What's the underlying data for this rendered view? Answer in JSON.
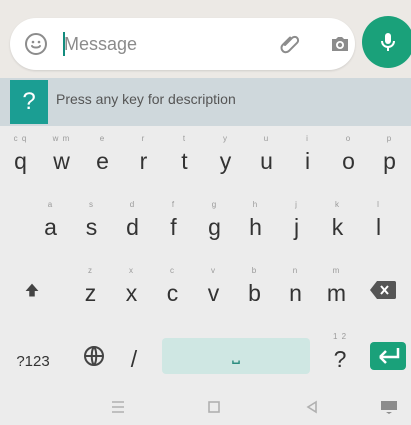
{
  "message": {
    "placeholder": "Message"
  },
  "hint": {
    "badge": "?",
    "text": "Press any key for description"
  },
  "keyboard": {
    "row1": [
      {
        "k": "q",
        "s": "c q"
      },
      {
        "k": "w",
        "s": "w m"
      },
      {
        "k": "e",
        "s": "e"
      },
      {
        "k": "r",
        "s": "r"
      },
      {
        "k": "t",
        "s": "t"
      },
      {
        "k": "y",
        "s": "y"
      },
      {
        "k": "u",
        "s": "u"
      },
      {
        "k": "i",
        "s": "i"
      },
      {
        "k": "o",
        "s": "o"
      },
      {
        "k": "p",
        "s": "p"
      }
    ],
    "row2": [
      {
        "k": "a",
        "s": "a"
      },
      {
        "k": "s",
        "s": "s"
      },
      {
        "k": "d",
        "s": "d"
      },
      {
        "k": "f",
        "s": "f"
      },
      {
        "k": "g",
        "s": "g"
      },
      {
        "k": "h",
        "s": "h"
      },
      {
        "k": "j",
        "s": "j"
      },
      {
        "k": "k",
        "s": "k"
      },
      {
        "k": "l",
        "s": "l"
      }
    ],
    "row3": [
      {
        "k": "z",
        "s": "z"
      },
      {
        "k": "x",
        "s": "x"
      },
      {
        "k": "c",
        "s": "c"
      },
      {
        "k": "v",
        "s": "v"
      },
      {
        "k": "b",
        "s": "b"
      },
      {
        "k": "n",
        "s": "n"
      },
      {
        "k": "m",
        "s": "m"
      }
    ],
    "row4": {
      "symbols": "?123",
      "slash": "/",
      "space": "⎵",
      "question": "?"
    }
  },
  "colors": {
    "accent": "#1aa17a",
    "hint_bg": "#cfd8dc",
    "badge": "#1b9e93"
  }
}
